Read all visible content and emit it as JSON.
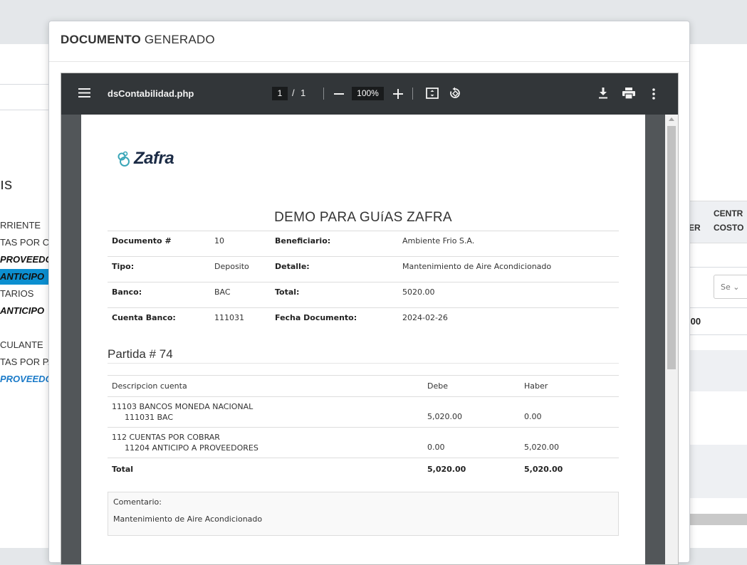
{
  "background": {
    "heading": "ıs",
    "left_items": [
      "RRIENTE",
      "TAS POR CO",
      "PROVEEDO",
      "ANTICIPO",
      "TARIOS",
      "ANTICIPO",
      "CULANTE",
      "TAS POR PA",
      "PROVEEDO"
    ],
    "table_headers": [
      "ER",
      "CENTR",
      "COSTO"
    ],
    "select_value": "Se",
    "total_value": ".00"
  },
  "modal": {
    "title_bold": "DOCUMENTO",
    "title_rest": "GENERADO"
  },
  "viewer": {
    "file_name": "dsContabilidad.php",
    "page_current": "1",
    "page_separator": "/",
    "page_total": "1",
    "zoom": "100%",
    "icons": [
      "menu-icon",
      "zoom-out-icon",
      "zoom-in-icon",
      "fit-page-icon",
      "rotate-icon",
      "download-icon",
      "print-icon",
      "more-icon"
    ]
  },
  "document": {
    "logo_text": "Zafra",
    "title": "DEMO PARA GUíAS ZAFRA",
    "info_rows": [
      {
        "l1": "Documento #",
        "v1": "10",
        "l2": "Beneficiario:",
        "v2": "Ambiente Frio S.A."
      },
      {
        "l1": "Tipo:",
        "v1": "Deposito",
        "l2": "Detalle:",
        "v2": "Mantenimiento de Aire Acondicionado"
      },
      {
        "l1": "Banco:",
        "v1": "BAC",
        "l2": "Total:",
        "v2": "5020.00"
      },
      {
        "l1": "Cuenta Banco:",
        "v1": "111031",
        "l2": "Fecha Documento:",
        "v2": "2024-02-26"
      }
    ],
    "partida_title": "Partida # 74",
    "entries_header": {
      "account": "Descripcion cuenta",
      "debe": "Debe",
      "haber": "Haber"
    },
    "entries": [
      {
        "account": "11103 BANCOS MONEDA NACIONAL",
        "sub": "111031 BAC",
        "debe": "5,020.00",
        "haber": "0.00"
      },
      {
        "account": "112 CUENTAS POR COBRAR",
        "sub": "11204 ANTICIPO A PROVEEDORES",
        "debe": "0.00",
        "haber": "5,020.00"
      }
    ],
    "totals": {
      "label": "Total",
      "debe": "5,020.00",
      "haber": "5,020.00"
    },
    "comment_label": "Comentario:",
    "comment_text": "Mantenimiento de Aire Acondicionado"
  }
}
